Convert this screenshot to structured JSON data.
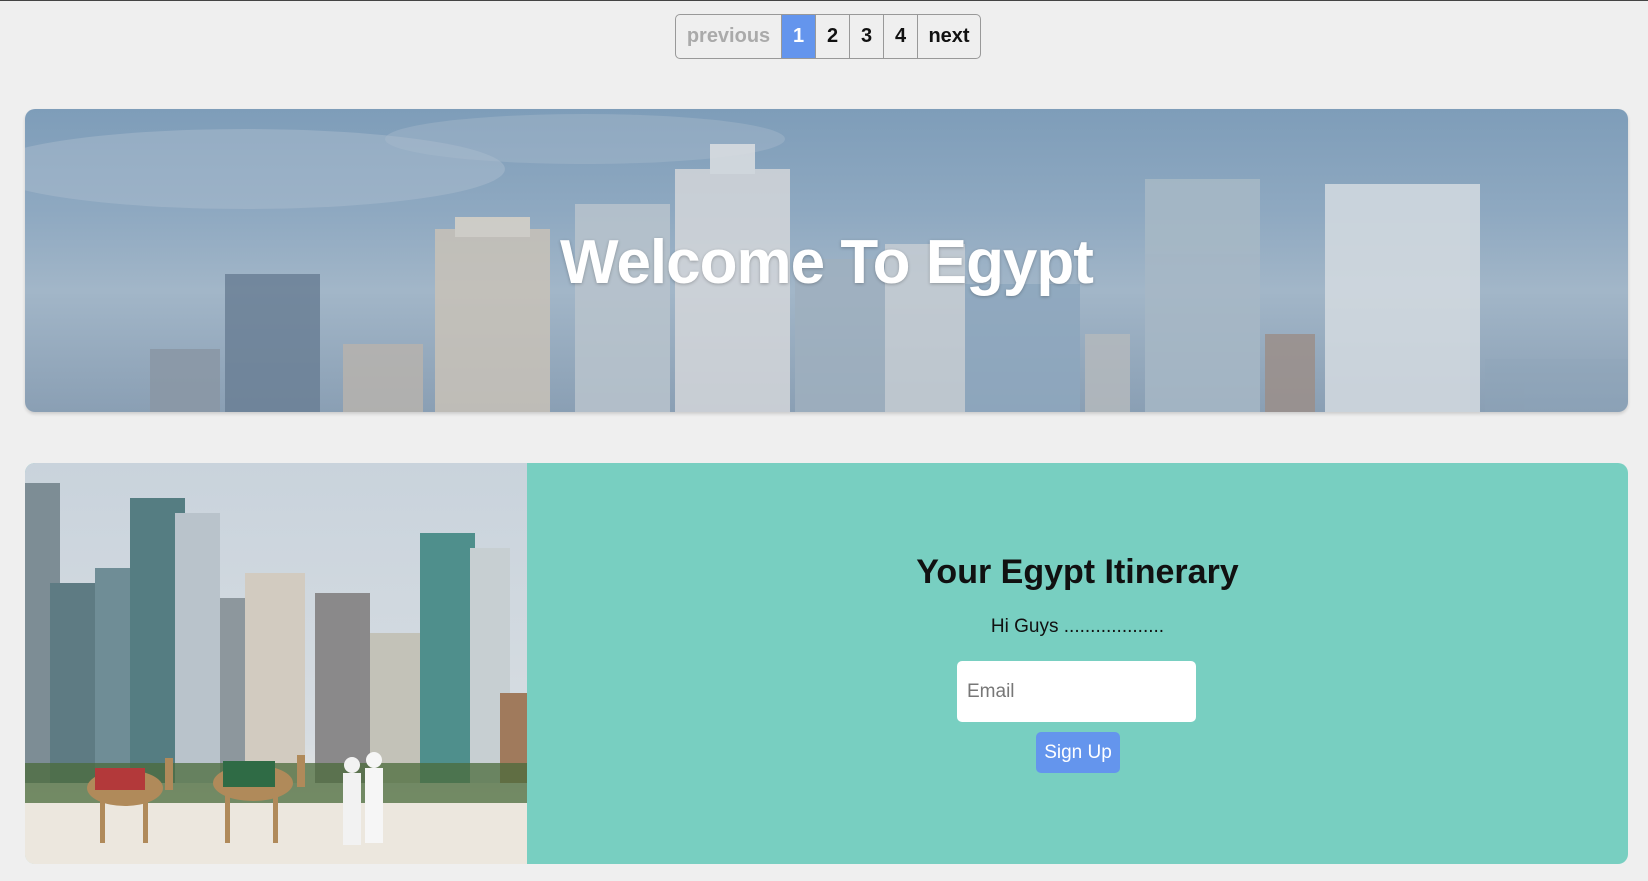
{
  "pagination": {
    "previous_label": "previous",
    "pages": [
      "1",
      "2",
      "3",
      "4"
    ],
    "active_page": "1",
    "next_label": "next"
  },
  "hero": {
    "title": "Welcome To Egypt"
  },
  "signup_card": {
    "title": "Your Egypt Itinerary",
    "text": "Hi Guys ...................",
    "email_placeholder": "Email",
    "button_label": "Sign Up"
  },
  "colors": {
    "page_background": "#efefef",
    "accent_blue": "#6495ed",
    "card_teal": "#78cfc1"
  }
}
